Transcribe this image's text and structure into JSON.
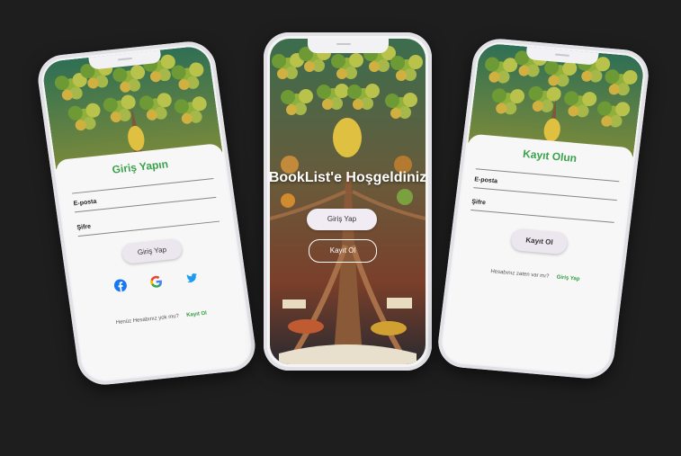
{
  "login": {
    "title": "Giriş Yapın",
    "email_label": "E-posta",
    "password_label": "Şifre",
    "login_button": "Giriş Yap",
    "footer_text": "Henüz Hesabınız yok mu?",
    "footer_link": "Kayıt Ol",
    "social": [
      "facebook",
      "google",
      "twitter"
    ]
  },
  "welcome": {
    "headline": "BookList'e Hoşgeldiniz",
    "login_button": "Giriş Yap",
    "register_button": "Kayıt Ol"
  },
  "register": {
    "title": "Kayıt Olun",
    "email_label": "E-posta",
    "password_label": "Şifre",
    "register_button": "Kayıt Ol",
    "footer_text": "Hesabınız zaten var mı?",
    "footer_link": "Giriş Yap"
  },
  "colors": {
    "background": "#1e1e1e",
    "accent_green": "#3aa24a",
    "button_fill": "#ece6ee",
    "facebook": "#1877f2",
    "twitter": "#1d9bf0"
  }
}
